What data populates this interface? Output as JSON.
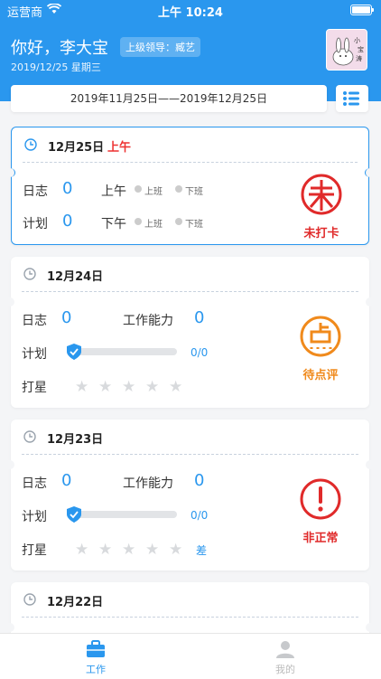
{
  "status": {
    "carrier": "运营商",
    "time": "上午 10:24"
  },
  "header": {
    "greeting": "你好，李大宝",
    "leader": "上级领导：臧艺",
    "date": "2019/12/25 星期三",
    "avatar_text": "小宝涛"
  },
  "range": {
    "text": "2019年11月25日——2019年12月25日"
  },
  "cards": [
    {
      "date": "12月25日",
      "half": "上午",
      "rows": {
        "log_label": "日志",
        "log_value": "0",
        "plan_label": "计划",
        "plan_value": "0",
        "am_label": "上午",
        "pm_label": "下午",
        "on": "上班",
        "off": "下班"
      },
      "stamp": "未打卡",
      "stamp_color": "#e02a2a"
    },
    {
      "date": "12月24日",
      "rows": {
        "log_label": "日志",
        "log_value": "0",
        "ability_label": "工作能力",
        "ability_value": "0",
        "plan_label": "计划",
        "plan_ratio": "0/0",
        "star_label": "打星"
      },
      "progress": 0,
      "stamp": "待点评",
      "stamp_color": "#f08a1c"
    },
    {
      "date": "12月23日",
      "rows": {
        "log_label": "日志",
        "log_value": "0",
        "ability_label": "工作能力",
        "ability_value": "0",
        "plan_label": "计划",
        "plan_ratio": "0/0",
        "star_label": "打星",
        "star_note": "差"
      },
      "progress": 0,
      "stamp": "非正常",
      "stamp_color": "#e02a2a"
    },
    {
      "date": "12月22日"
    }
  ],
  "tabs": [
    {
      "label": "工作",
      "active": true
    },
    {
      "label": "我的",
      "active": false
    }
  ],
  "colors": {
    "primary": "#2a97ee",
    "red": "#e02a2a",
    "orange": "#f08a1c"
  }
}
